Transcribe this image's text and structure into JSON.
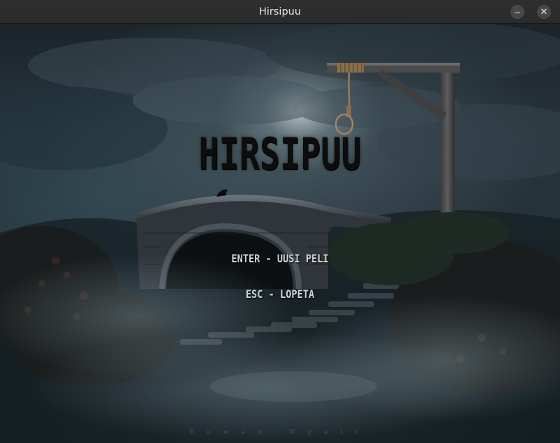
{
  "window": {
    "title": "Hirsipuu",
    "minimize_icon": "minimize-icon",
    "close_icon": "close-icon",
    "close_glyph": "✕"
  },
  "game": {
    "title": "HIRSIPUU",
    "menu": [
      {
        "label": "ENTER - UUSI PELI"
      },
      {
        "label": "ESC - LOPETA"
      }
    ],
    "artist_signature": "Rowan Wyatt"
  },
  "colors": {
    "titlebar": "#2f2f2f",
    "title_text": "#e6e6e6",
    "game_title": "#0d0d0d",
    "menu_text": "#cfd3d5"
  }
}
